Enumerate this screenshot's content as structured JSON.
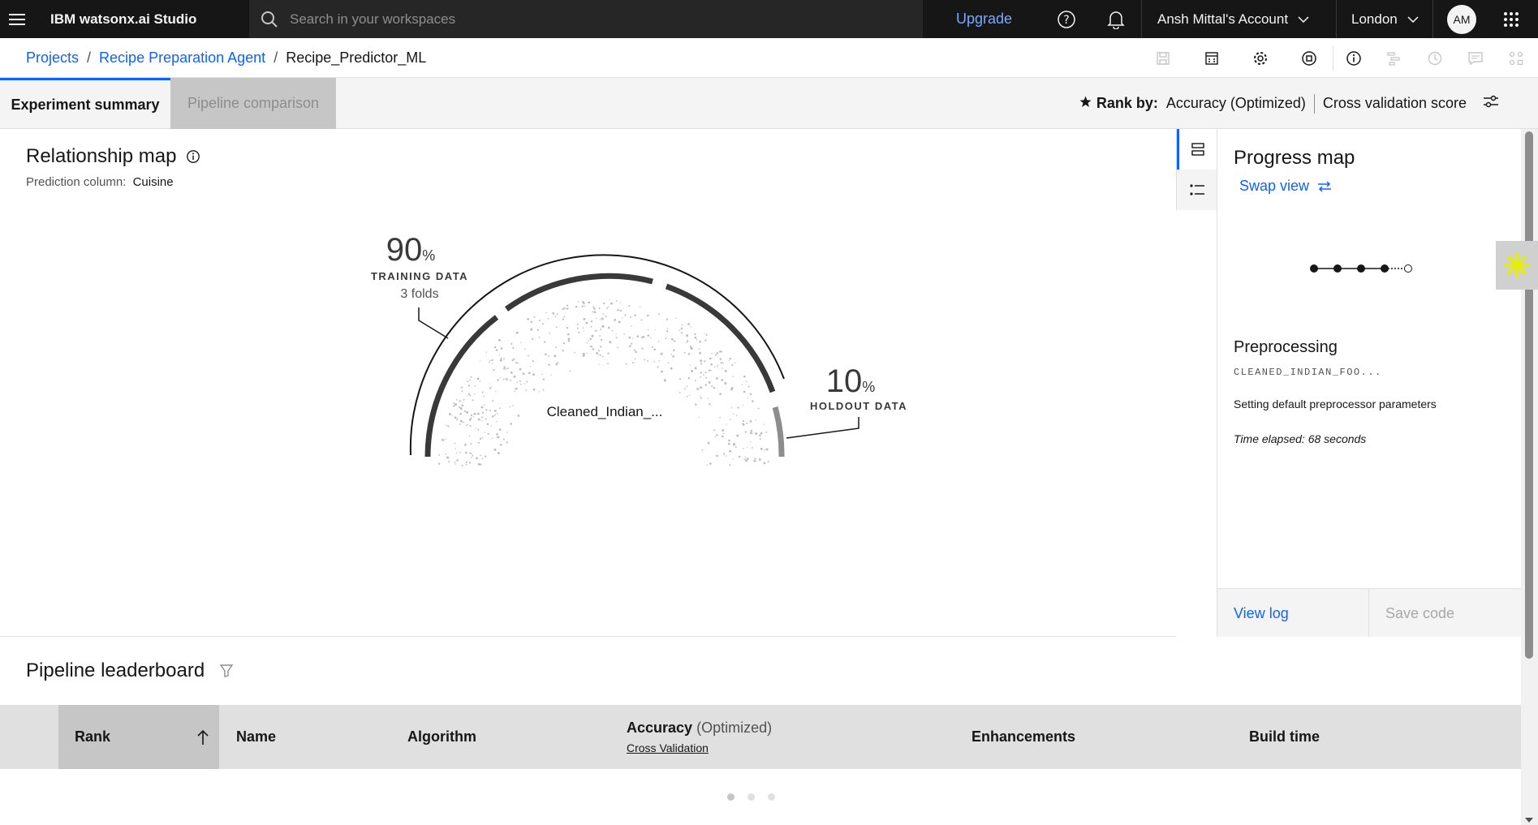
{
  "topbar": {
    "brand": "IBM watsonx.ai Studio",
    "search_placeholder": "Search in your workspaces",
    "upgrade": "Upgrade",
    "account": "Ansh Mittal's Account",
    "region": "London",
    "avatar_initials": "AM"
  },
  "breadcrumb": {
    "items": [
      "Projects",
      "Recipe Preparation Agent"
    ],
    "current": "Recipe_Predictor_ML"
  },
  "tabs": {
    "summary": "Experiment summary",
    "comparison": "Pipeline comparison"
  },
  "rank_by": {
    "label": "Rank by:",
    "metric": "Accuracy (Optimized)",
    "score": "Cross validation score"
  },
  "relationship_map": {
    "title": "Relationship map",
    "prediction_label": "Prediction column:",
    "prediction_value": "Cuisine",
    "training_pct": "90",
    "training_pct_unit": "%",
    "training_label": "TRAINING DATA",
    "training_folds": "3 folds",
    "holdout_pct": "10",
    "holdout_pct_unit": "%",
    "holdout_label": "HOLDOUT DATA",
    "dataset_name": "Cleaned_Indian_..."
  },
  "progress_map": {
    "title": "Progress map",
    "swap_view": "Swap view",
    "stage": "Preprocessing",
    "file": "CLEANED_INDIAN_FOO...",
    "status": "Setting default preprocessor parameters",
    "time_elapsed": "Time elapsed: 68 seconds",
    "view_log": "View log",
    "save_code": "Save code",
    "steps_completed": 4,
    "steps_total": 5
  },
  "leaderboard": {
    "title": "Pipeline leaderboard",
    "columns": {
      "rank": "Rank",
      "name": "Name",
      "algorithm": "Algorithm",
      "accuracy": "Accuracy",
      "accuracy_opt": "(Optimized)",
      "cross_validation": "Cross Validation",
      "enhancements": "Enhancements",
      "build_time": "Build time"
    }
  },
  "colors": {
    "accent": "#0f62fe",
    "topbar": "#161616",
    "link_dark": "#78a9ff",
    "assistant": "#e5f000"
  }
}
